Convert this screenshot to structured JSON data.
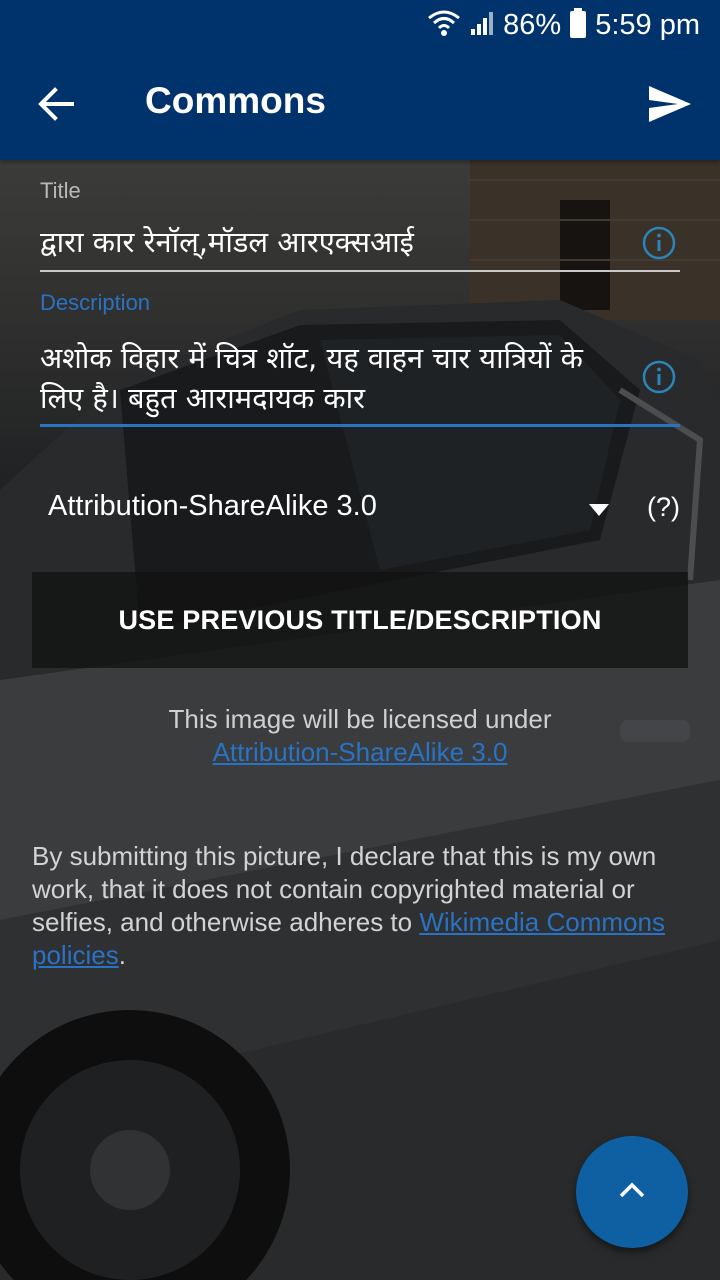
{
  "status_bar": {
    "battery_percent": "86%",
    "time": "5:59 pm",
    "icons": [
      "wifi-icon",
      "signal-icon",
      "battery-icon"
    ]
  },
  "app_bar": {
    "title": "Commons",
    "back_icon": "arrow-back-icon",
    "send_icon": "send-icon"
  },
  "form": {
    "title_label": "Title",
    "title_value": "द्वारा कार रेनॉल्,मॉडल आरएक्सआई",
    "description_label": "Description",
    "description_value": "अशोक विहार में चित्र शॉट, यह वाहन चार यात्रियों के लिए है। बहुत आरामदायक कार",
    "license_selected": "Attribution-ShareAlike 3.0",
    "license_help": "(?)",
    "prev_button_label": "USE PREVIOUS TITLE/DESCRIPTION",
    "licensed_under_text": "This image will be licensed under",
    "license_link_text": "Attribution-ShareAlike 3.0",
    "declaration_text": "By submitting this picture, I declare that this is my own work, that it does not contain copyrighted material or selfies, and otherwise adheres to",
    "policy_link_text": "Wikimedia Commons policies",
    "declaration_end": "."
  },
  "fab": {
    "icon": "chevron-up-icon"
  },
  "colors": {
    "app_bar": "#00336b",
    "accent": "#2a73c4",
    "fab": "#0f5fa3"
  }
}
